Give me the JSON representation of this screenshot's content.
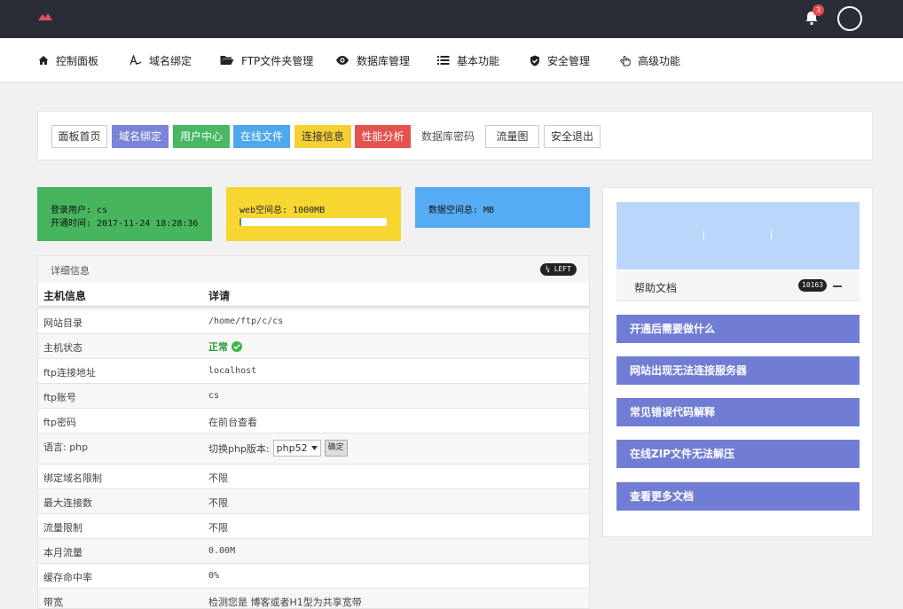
{
  "topbar": {
    "notification_count": "3"
  },
  "nav": [
    {
      "label": "控制面板",
      "icon": "home-icon"
    },
    {
      "label": "域名绑定",
      "icon": "text-icon"
    },
    {
      "label": "FTP文件夹管理",
      "icon": "folder-open-icon"
    },
    {
      "label": "数据库管理",
      "icon": "eye-icon"
    },
    {
      "label": "基本功能",
      "icon": "list-icon"
    },
    {
      "label": "安全管理",
      "icon": "shield-check-icon"
    },
    {
      "label": "高级功能",
      "icon": "pointer-hand-icon"
    }
  ],
  "quick_buttons": [
    {
      "label": "面板首页",
      "style": "default"
    },
    {
      "label": "域名绑定",
      "style": "purple"
    },
    {
      "label": "用户中心",
      "style": "green"
    },
    {
      "label": "在线文件",
      "style": "blue"
    },
    {
      "label": "连接信息",
      "style": "yellow"
    },
    {
      "label": "性能分析",
      "style": "red"
    },
    {
      "label": "数据库密码",
      "style": "plain"
    },
    {
      "label": "流量图",
      "style": "default"
    },
    {
      "label": "安全退出",
      "style": "default"
    }
  ],
  "stats": {
    "login_user": "登录用户: cs",
    "open_time": "开通时间: 2017-11-24 18:28:36",
    "web_space": "web空间总: 1000MB",
    "web_space_used_fraction": 0.01,
    "db_space": "数据空间总: MB"
  },
  "detail": {
    "title": "详细信息",
    "left_badge": "¼ LEFT",
    "header": {
      "key": "主机信息",
      "value": "详请"
    },
    "rows": [
      {
        "key": "网站目录",
        "value": "/home/ftp/c/cs"
      },
      {
        "key": "主机状态",
        "value": "正常"
      },
      {
        "key": "ftp连接地址",
        "value": "localhost"
      },
      {
        "key": "ftp账号",
        "value": "cs"
      },
      {
        "key": "ftp密码",
        "value": "在前台查看"
      },
      {
        "key": "语言: php",
        "value": "切换php版本:"
      },
      {
        "key": "绑定域名限制",
        "value": "不限"
      },
      {
        "key": "最大连接数",
        "value": "不限"
      },
      {
        "key": "流量限制",
        "value": "不限"
      },
      {
        "key": "本月流量",
        "value": "0.00M"
      },
      {
        "key": "缓存命中率",
        "value": "0%"
      },
      {
        "key": "带宽",
        "value": "检测您是 博客或者H1型为共享宽带"
      }
    ],
    "php_select": "php52",
    "confirm_label": "确定"
  },
  "side": {
    "help_label": "帮助文档",
    "help_count": "10163",
    "docs": [
      "开通后需要做什么",
      "网站出现无法连接服务器",
      "常见错误代码解释",
      "在线ZIP文件无法解压",
      "查看更多文档"
    ]
  },
  "colors": {
    "topbar": "#2a2d35",
    "brand_logo": "#e0506a",
    "green": "#46b55e",
    "yellow": "#f7d631",
    "blue": "#56acf2",
    "purple": "#717dd5",
    "red": "#e4524f"
  }
}
